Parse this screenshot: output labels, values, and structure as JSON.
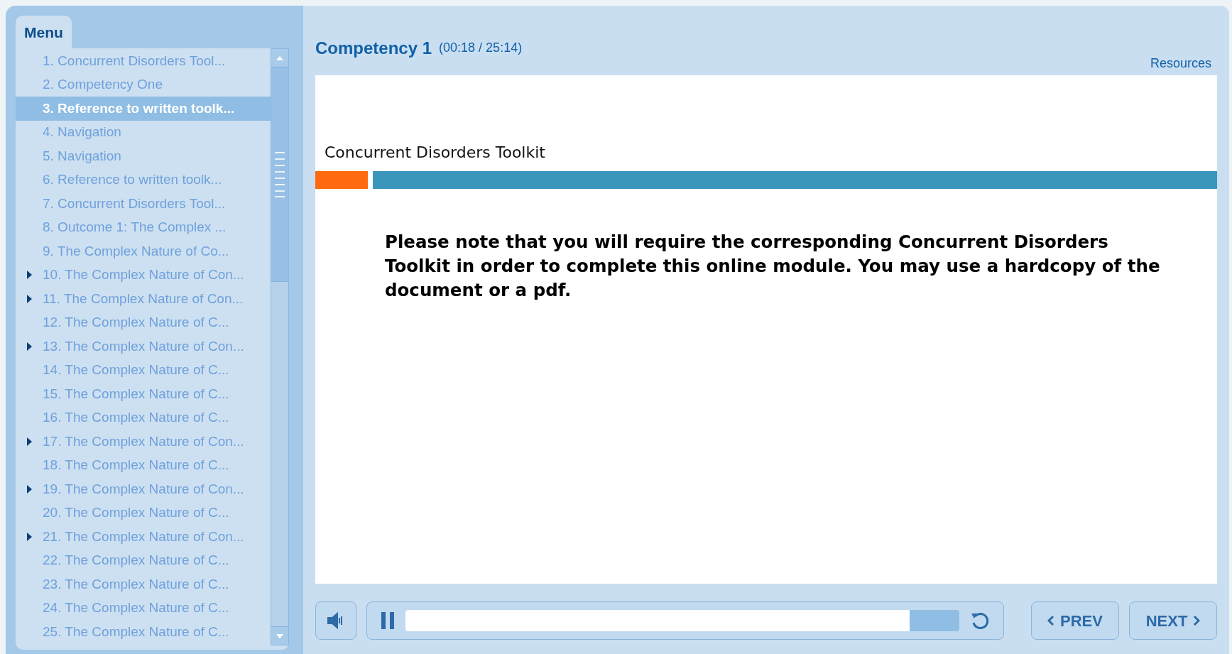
{
  "menu": {
    "tab": "Menu",
    "items": [
      {
        "label": "1. Concurrent Disorders Tool...",
        "kind": "page",
        "selected": false
      },
      {
        "label": "2. Competency One",
        "kind": "page",
        "selected": false
      },
      {
        "label": "3. Reference to written toolk...",
        "kind": "page",
        "selected": true
      },
      {
        "label": "4. Navigation",
        "kind": "page",
        "selected": false
      },
      {
        "label": "5. Navigation",
        "kind": "page",
        "selected": false
      },
      {
        "label": "6. Reference to written toolk...",
        "kind": "page",
        "selected": false
      },
      {
        "label": "7. Concurrent Disorders Tool...",
        "kind": "page",
        "selected": false
      },
      {
        "label": "8. Outcome 1: The Complex ...",
        "kind": "page",
        "selected": false
      },
      {
        "label": "9. The Complex Nature of Co...",
        "kind": "page",
        "selected": false
      },
      {
        "label": "10. The Complex Nature of Con...",
        "kind": "group",
        "selected": false
      },
      {
        "label": "11. The Complex Nature of Con...",
        "kind": "group",
        "selected": false
      },
      {
        "label": "12. The Complex Nature of C...",
        "kind": "page",
        "selected": false
      },
      {
        "label": "13. The Complex Nature of Con...",
        "kind": "group",
        "selected": false
      },
      {
        "label": "14. The Complex Nature of C...",
        "kind": "page",
        "selected": false
      },
      {
        "label": "15. The Complex Nature of C...",
        "kind": "page",
        "selected": false
      },
      {
        "label": "16. The Complex Nature of C...",
        "kind": "page",
        "selected": false
      },
      {
        "label": "17. The Complex Nature of Con...",
        "kind": "group",
        "selected": false
      },
      {
        "label": "18. The Complex Nature of C...",
        "kind": "page",
        "selected": false
      },
      {
        "label": "19. The Complex Nature of Con...",
        "kind": "group",
        "selected": false
      },
      {
        "label": "20. The Complex Nature of C...",
        "kind": "page",
        "selected": false
      },
      {
        "label": "21. The Complex Nature of Con...",
        "kind": "group",
        "selected": false
      },
      {
        "label": "22. The Complex Nature of C...",
        "kind": "page",
        "selected": false
      },
      {
        "label": "23. The Complex Nature of C...",
        "kind": "page",
        "selected": false
      },
      {
        "label": "24. The Complex Nature of C...",
        "kind": "page",
        "selected": false
      },
      {
        "label": "25. The Complex Nature of C...",
        "kind": "page",
        "selected": false
      }
    ]
  },
  "header": {
    "title": "Competency 1",
    "time": "(00:18 / 25:14)",
    "resources": "Resources"
  },
  "slide": {
    "heading": "Concurrent Disorders Toolkit",
    "body": "Please note that you will require the corresponding Concurrent Disorders Toolkit in order to complete this online module. You may use a hardcopy of the document or a pdf."
  },
  "player": {
    "level": 0.91,
    "prev": "PREV",
    "next": "NEXT"
  }
}
